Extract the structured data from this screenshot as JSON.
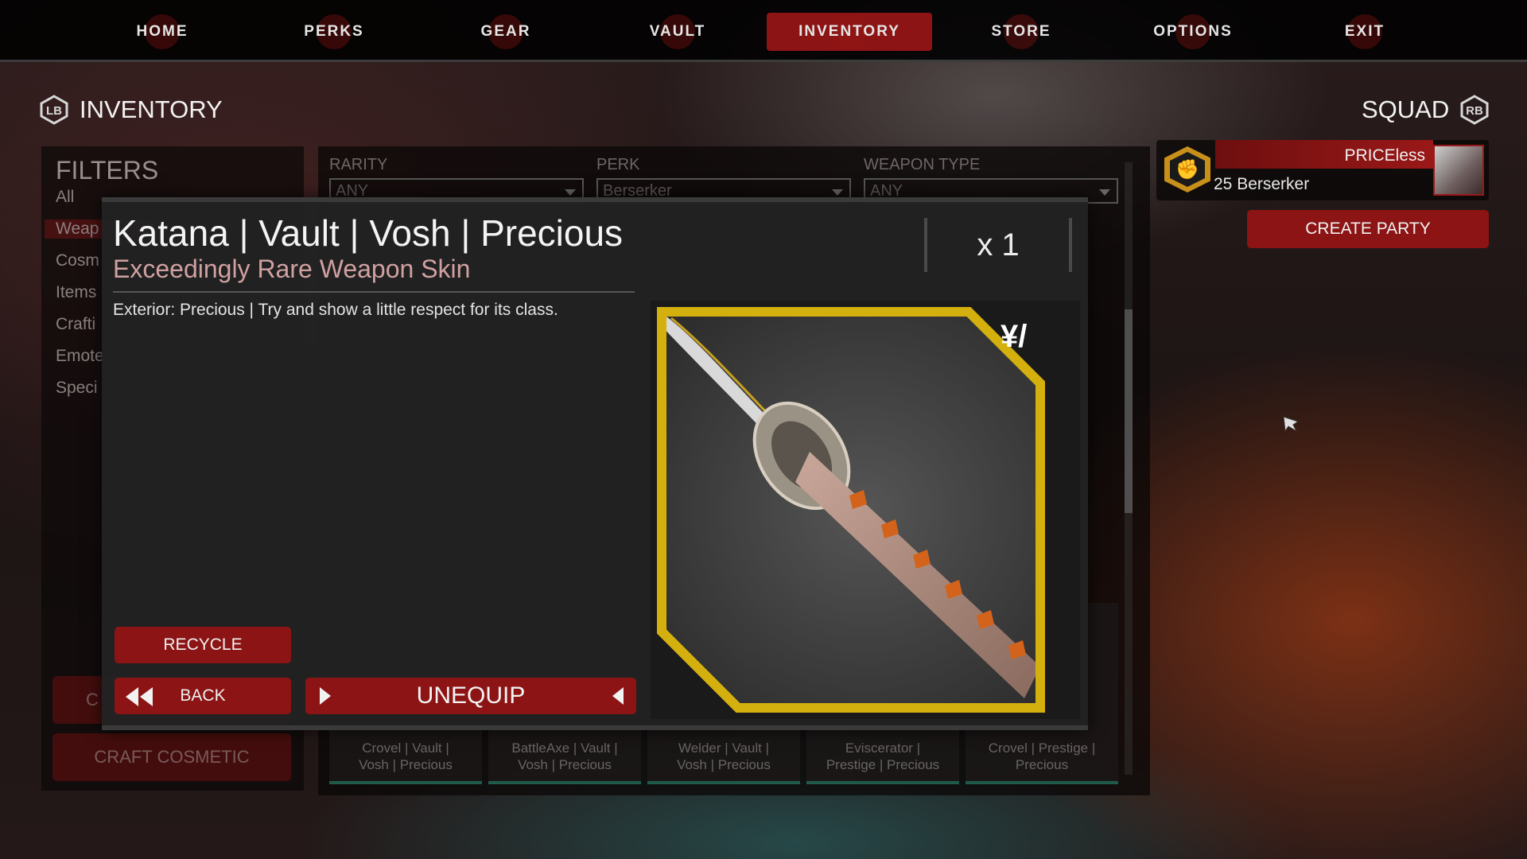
{
  "nav": {
    "items": [
      {
        "label": "HOME"
      },
      {
        "label": "PERKS"
      },
      {
        "label": "GEAR"
      },
      {
        "label": "VAULT"
      },
      {
        "label": "INVENTORY"
      },
      {
        "label": "STORE"
      },
      {
        "label": "OPTIONS"
      },
      {
        "label": "EXIT"
      }
    ],
    "active": "INVENTORY"
  },
  "inventory_header": {
    "title": "INVENTORY"
  },
  "squad_header": {
    "title": "SQUAD"
  },
  "filters": {
    "title": "FILTERS",
    "items": [
      "All",
      "Weap",
      "Cosm",
      "Items",
      "Crafti",
      "Emote",
      "Speci"
    ],
    "selected": "Weap",
    "craft_cosmetic_label": "CRAFT COSMETIC",
    "faded_button_label": "C"
  },
  "grid_filters": {
    "rarity": {
      "label": "RARITY",
      "value": "ANY"
    },
    "perk": {
      "label": "PERK",
      "value": "Berserker"
    },
    "weapon_type": {
      "label": "WEAPON TYPE",
      "value": "ANY"
    }
  },
  "grid_tiles": [
    {
      "line1": "Crovel | Vault |",
      "line2": "Vosh | Precious"
    },
    {
      "line1": "BattleAxe | Vault |",
      "line2": "Vosh | Precious"
    },
    {
      "line1": "Welder | Vault |",
      "line2": "Vosh | Precious"
    },
    {
      "line1": "Eviscerator |",
      "line2": "Prestige | Precious"
    },
    {
      "line1": "Crovel | Prestige |",
      "line2": "Precious"
    }
  ],
  "squad": {
    "player_name": "PRICEless",
    "player_level": "25 Berserker",
    "create_party_label": "CREATE PARTY"
  },
  "modal": {
    "title": "Katana | Vault | Vosh | Precious",
    "subtitle": "Exceedingly Rare Weapon Skin",
    "description": "Exterior: Precious | Try and show a little respect for its class.",
    "quantity": "x 1",
    "recycle_label": "RECYCLE",
    "back_label": "BACK",
    "unequip_label": "UNEQUIP",
    "rarity_color": "#d4b00e",
    "accent_color": "#8c1414"
  }
}
